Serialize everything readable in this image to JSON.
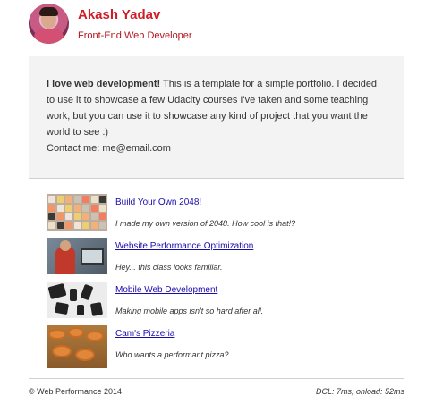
{
  "header": {
    "name": "Akash Yadav",
    "role": "Front-End Web Developer"
  },
  "intro": {
    "bold": "I love web development!",
    "text": " This is a template for a simple portfolio. I decided to use it to showcase a few Udacity courses I've taken and some teaching work, but you can use it to showcase any kind of project that you want the world to see :)",
    "contact": "Contact me: me@email.com"
  },
  "projects": [
    {
      "title": "Build Your Own 2048!",
      "description": "I made my own version of 2048. How cool is that!?"
    },
    {
      "title": "Website Performance Optimization",
      "description": "Hey... this class looks familiar."
    },
    {
      "title": "Mobile Web Development",
      "description": "Making mobile apps isn't so hard after all."
    },
    {
      "title": "Cam's Pizzeria",
      "description": "Who wants a performant pizza?"
    }
  ],
  "footer": {
    "copyright": "© Web Performance 2014",
    "timing": "DCL: 7ms, onload: 52ms"
  },
  "colors": {
    "accent": "#cc1f2a",
    "link": "#1a0dab",
    "intro_bg": "#f3f3f3"
  }
}
